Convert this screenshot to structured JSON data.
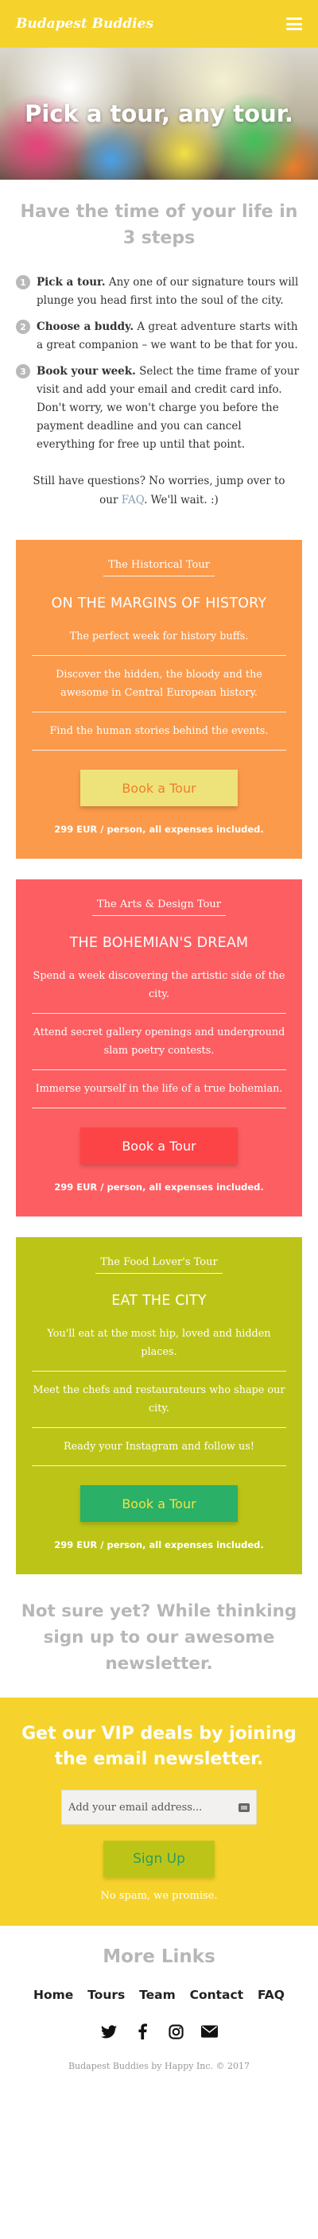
{
  "header": {
    "logo": "Budapest Buddies",
    "menu_icon": "hamburger-menu-icon"
  },
  "hero": {
    "title": "Pick a tour, any tour."
  },
  "intro": {
    "title": "Have the time of your life in 3 steps",
    "steps": [
      {
        "num": "1",
        "bold": "Pick a tour.",
        "text": " Any one of our signature tours will plunge you head first into the soul of the city."
      },
      {
        "num": "2",
        "bold": "Choose a buddy.",
        "text": " A great adventure starts with a great companion – we want to be that for you."
      },
      {
        "num": "3",
        "bold": "Book your week.",
        "text": " Select the time frame of your visit and add your email and credit card info. Don't worry, we won't charge you before the payment deadline and you can cancel everything for free up until that point."
      }
    ],
    "questions_pre": "Still have questions? No worries, jump over to our ",
    "questions_link": "FAQ",
    "questions_post": ". We'll wait. :)"
  },
  "tours": [
    {
      "title": "The Historical Tour",
      "name": "ON THE MARGINS OF HISTORY",
      "points": [
        "The perfect week for history buffs.",
        "Discover the hidden, the bloody and the awesome in Central European history.",
        "Find the human stories behind the events."
      ],
      "button": "Book a Tour",
      "price": "299 EUR / person, all expenses included."
    },
    {
      "title": "The Arts & Design Tour",
      "name": "THE BOHEMIAN'S DREAM",
      "points": [
        "Spend a week discovering the artistic side of the city.",
        "Attend secret gallery openings and underground slam poetry contests.",
        "Immerse yourself in the life of a true bohemian."
      ],
      "button": "Book a Tour",
      "price": "299 EUR / person, all expenses included."
    },
    {
      "title": "The Food Lover's Tour",
      "name": "EAT THE CITY",
      "points": [
        "You'll eat at the most hip, loved and hidden places.",
        "Meet the chefs and restaurateurs who shape our city.",
        "Ready your Instagram and follow us!"
      ],
      "button": "Book a Tour",
      "price": "299 EUR / person, all expenses included."
    }
  ],
  "newsletter_cta": {
    "title": "Not sure yet? While thinking sign up to our awesome newsletter."
  },
  "vip": {
    "title": "Get our VIP deals by joining the email newsletter.",
    "email_placeholder": "Add your email address...",
    "signup_button": "Sign Up",
    "spam_note": "No spam, we promise."
  },
  "footer": {
    "title": "More Links",
    "nav": [
      "Home",
      "Tours",
      "Team",
      "Contact",
      "FAQ"
    ],
    "social_icons": [
      "twitter-icon",
      "facebook-icon",
      "instagram-icon",
      "envelope-icon"
    ],
    "copyright": "Budapest Buddies by Happy Inc. © 2017"
  },
  "colors": {
    "yellow": "#f6d32c",
    "orange_card": "#fb9a4b",
    "red_card": "#fd5e61",
    "lime_card": "#bcc517",
    "heading_gray": "#b7b7b7"
  }
}
